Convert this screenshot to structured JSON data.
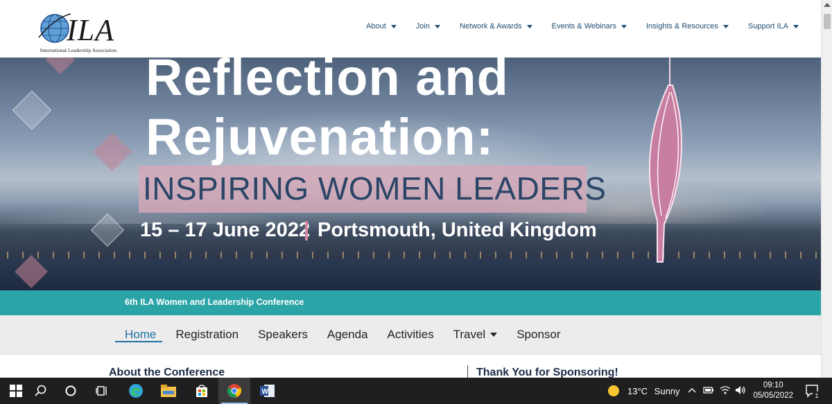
{
  "logo": {
    "text": "ILA",
    "subtitle": "International Leadership Association"
  },
  "nav": {
    "items": [
      {
        "label": "About",
        "dropdown": true
      },
      {
        "label": "Join",
        "dropdown": true
      },
      {
        "label": "Network & Awards",
        "dropdown": true
      },
      {
        "label": "Events & Webinars",
        "dropdown": true
      },
      {
        "label": "Insights & Resources",
        "dropdown": true
      },
      {
        "label": "Support ILA",
        "dropdown": true
      }
    ]
  },
  "hero": {
    "title_line1": "Reflection and",
    "title_line2": "Rejuvenation:",
    "subtitle": "INSPIRING WOMEN LEADERS",
    "dates": "15 – 17 June 2022",
    "location": "Portsmouth, United Kingdom"
  },
  "banner": {
    "text": "6th ILA Women and Leadership Conference",
    "color": "#2ba4a8"
  },
  "subnav": {
    "items": [
      {
        "label": "Home",
        "active": true
      },
      {
        "label": "Registration"
      },
      {
        "label": "Speakers"
      },
      {
        "label": "Agenda"
      },
      {
        "label": "Activities"
      },
      {
        "label": "Travel",
        "dropdown": true
      },
      {
        "label": "Sponsor"
      }
    ]
  },
  "content": {
    "left_heading": "About the Conference",
    "right_heading": "Thank You for Sponsoring!"
  },
  "taskbar": {
    "apps": [
      "windows-start-icon",
      "search-icon",
      "cortana-icon",
      "task-view-icon",
      "edge-icon",
      "file-explorer-icon",
      "store-icon",
      "chrome-icon",
      "word-icon"
    ],
    "weather": {
      "temp": "13°C",
      "condition": "Sunny"
    },
    "time": "09:10",
    "date": "05/05/2022",
    "notification_count": "1"
  }
}
